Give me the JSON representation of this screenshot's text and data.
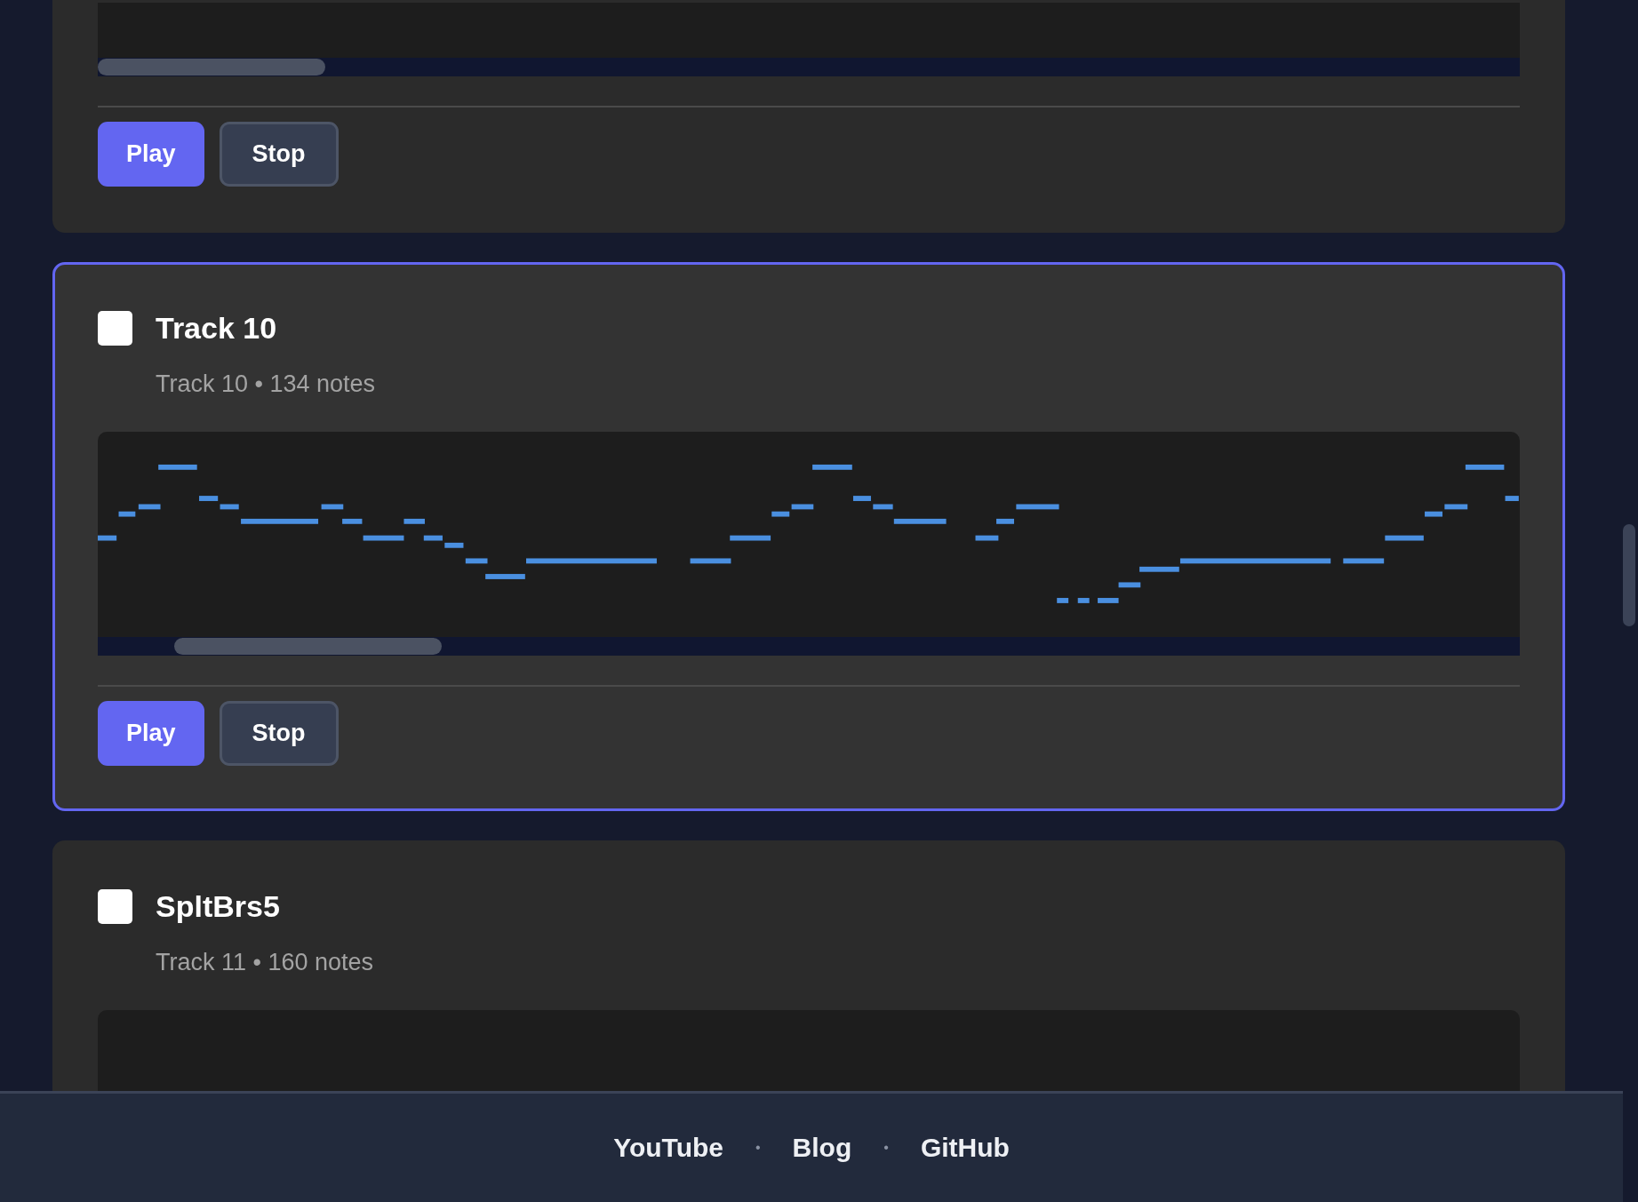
{
  "cards": [
    {
      "selected": false,
      "buttons": [
        "Play",
        "Stop"
      ]
    },
    {
      "selected": true,
      "checked": false,
      "title": "Track 10",
      "subtitle": "Track 10 • 134 notes",
      "buttons": [
        "Play",
        "Stop"
      ]
    },
    {
      "selected": false,
      "checked": false,
      "title": "SpltBrs5",
      "subtitle": "Track 11 • 160 notes"
    }
  ],
  "footer": {
    "links": [
      "YouTube",
      "Blog",
      "GitHub"
    ],
    "separator": "•"
  }
}
